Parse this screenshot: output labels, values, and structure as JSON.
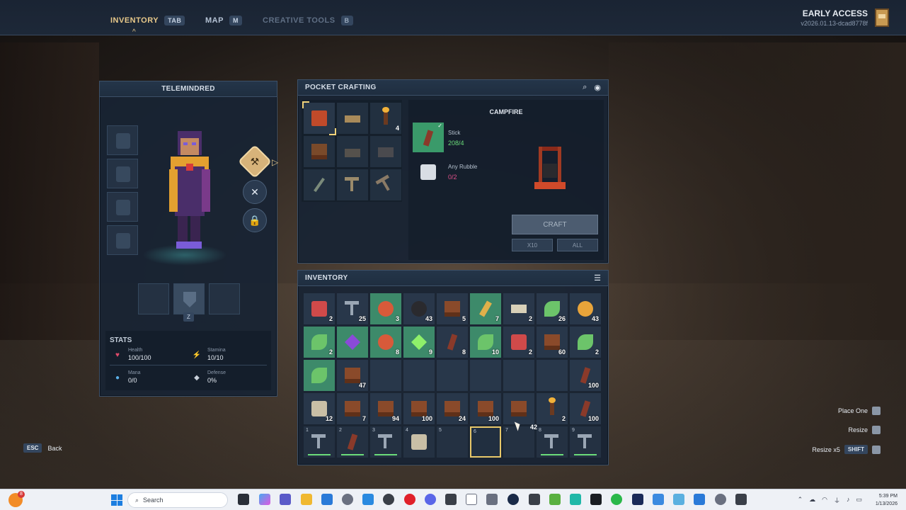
{
  "topbar": {
    "tabs": [
      {
        "label": "INVENTORY",
        "key": "TAB"
      },
      {
        "label": "MAP",
        "key": "M"
      },
      {
        "label": "CREATIVE TOOLS",
        "key": "B"
      }
    ],
    "early_access": "EARLY ACCESS",
    "version": "v2026.01.13-dcad8778f"
  },
  "character": {
    "name": "TELEMINDRED",
    "accessory_key": "Z",
    "stats_title": "STATS",
    "stats": [
      {
        "label": "Health",
        "value": "100/100"
      },
      {
        "label": "Stamina",
        "value": "10/10"
      },
      {
        "label": "Mana",
        "value": "0/0"
      },
      {
        "label": "Defense",
        "value": "0%"
      }
    ]
  },
  "crafting": {
    "title": "POCKET CRAFTING",
    "recipes": [
      {
        "icon": "campfire-icon",
        "count": ""
      },
      {
        "icon": "workbench-icon",
        "count": ""
      },
      {
        "icon": "torch-icon",
        "count": "4"
      },
      {
        "icon": "chest-icon",
        "count": ""
      },
      {
        "icon": "anvil-icon",
        "count": ""
      },
      {
        "icon": "forge-icon",
        "count": ""
      },
      {
        "icon": "sword-icon",
        "count": ""
      },
      {
        "icon": "hammer-icon",
        "count": ""
      },
      {
        "icon": "pickaxe-icon",
        "count": ""
      }
    ],
    "selected": {
      "name": "CAMPFIRE",
      "ingredients": [
        {
          "name": "Stick",
          "count": "208/4",
          "status_color": "#6bdc7a"
        },
        {
          "name": "Any Rubble",
          "count": "0/2",
          "status_color": "#e0508a"
        }
      ]
    },
    "craft_label": "CRAFT",
    "x10_label": "X10",
    "all_label": "ALL"
  },
  "inventory": {
    "title": "INVENTORY",
    "rows": [
      [
        {
          "i": "i-red",
          "c": "2"
        },
        {
          "i": "i-tool",
          "c": "25"
        },
        {
          "i": "i-orb",
          "c": "3",
          "h": 1
        },
        {
          "i": "i-dark",
          "c": "43"
        },
        {
          "i": "i-block",
          "c": "5"
        },
        {
          "i": "i-wheat",
          "c": "7",
          "h": 1
        },
        {
          "i": "i-paper",
          "c": "2"
        },
        {
          "i": "i-leaf",
          "c": "26"
        },
        {
          "i": "i-gold",
          "c": "43"
        }
      ],
      [
        {
          "i": "i-leaf",
          "c": "2",
          "h": 1
        },
        {
          "i": "i-gem",
          "c": "",
          "h": 1
        },
        {
          "i": "i-orb",
          "c": "8",
          "h": 1
        },
        {
          "i": "i-green",
          "c": "9",
          "h": 1
        },
        {
          "i": "i-stick",
          "c": "8"
        },
        {
          "i": "i-leaf",
          "c": "10",
          "h": 1
        },
        {
          "i": "i-red",
          "c": "2"
        },
        {
          "i": "i-block",
          "c": "60"
        },
        {
          "i": "i-leaf",
          "c": "2"
        }
      ],
      [
        {
          "i": "i-leaf",
          "c": "",
          "h": 1
        },
        {
          "i": "i-block",
          "c": "47"
        },
        {
          "i": "",
          "c": ""
        },
        {
          "i": "",
          "c": ""
        },
        {
          "i": "",
          "c": ""
        },
        {
          "i": "",
          "c": ""
        },
        {
          "i": "",
          "c": ""
        },
        {
          "i": "",
          "c": ""
        },
        {
          "i": "i-stick",
          "c": "100"
        }
      ],
      [
        {
          "i": "i-stone",
          "c": "12"
        },
        {
          "i": "i-block",
          "c": "7"
        },
        {
          "i": "i-block",
          "c": "94"
        },
        {
          "i": "i-block",
          "c": "100"
        },
        {
          "i": "i-block",
          "c": "24"
        },
        {
          "i": "i-block",
          "c": "100"
        },
        {
          "i": "i-block",
          "c": ""
        },
        {
          "i": "i-torch",
          "c": "2"
        },
        {
          "i": "i-stick",
          "c": "100"
        }
      ]
    ],
    "hotbar": [
      {
        "n": "1",
        "i": "i-tool",
        "bar": 1
      },
      {
        "n": "2",
        "i": "i-stick",
        "bar": 1
      },
      {
        "n": "3",
        "i": "i-tool",
        "bar": 1
      },
      {
        "n": "4",
        "i": "i-stone",
        "bar": 0
      },
      {
        "n": "5",
        "i": "",
        "bar": 0
      },
      {
        "n": "6",
        "i": "",
        "bar": 0
      },
      {
        "n": "7",
        "i": "",
        "bar": 0
      },
      {
        "n": "8",
        "i": "i-tool",
        "bar": 1
      },
      {
        "n": "9",
        "i": "i-tool",
        "bar": 1
      }
    ],
    "held_count": "42"
  },
  "prompts": {
    "place_one": "Place One",
    "resize": "Resize",
    "resize5": "Resize x5",
    "shift_key": "SHIFT",
    "esc_key": "ESC",
    "back": "Back"
  },
  "taskbar": {
    "notif_count": "8",
    "search_placeholder": "Search",
    "time": "5:39 PM",
    "date": "1/13/2026"
  }
}
